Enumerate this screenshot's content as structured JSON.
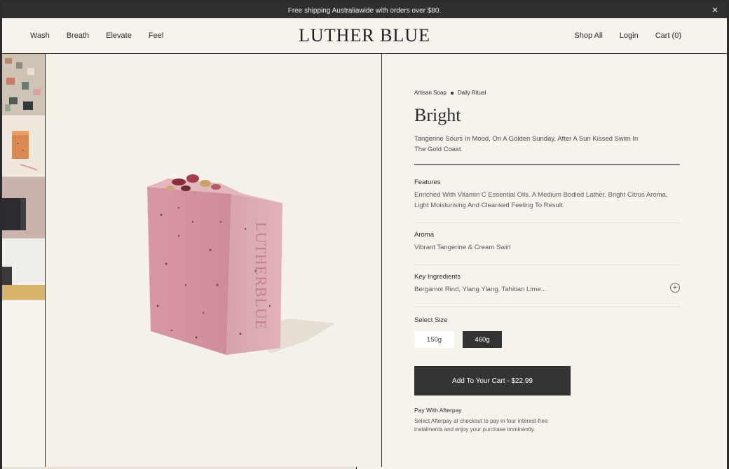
{
  "announcement": {
    "text": "Free shipping Australiawide with orders over $80."
  },
  "brand": {
    "logo": "LUTHER BLUE"
  },
  "nav": {
    "left": [
      "Wash",
      "Breath",
      "Elevate",
      "Feel"
    ],
    "shop_all": "Shop All",
    "login": "Login",
    "cart": "Cart (0)"
  },
  "product": {
    "breadcrumbs": [
      "Artisan Soap",
      "Daily Ritual"
    ],
    "title": "Bright",
    "tagline": "Tangerine Sours In Mood, On A Golden Sunday, After A Sun Kissed Swim In The Gold Coast.",
    "features": {
      "label": "Features",
      "text": "Enriched With Vitamin C Essential Oils. A Medium Bodied Lather. Bright Citrus Aroma, Light Moisturising And Cleansed Feeling To Result."
    },
    "aroma": {
      "label": "Aroma",
      "text": "Vibrant Tangerine & Cream Swirl"
    },
    "ingredients": {
      "label": "Key Ingredients",
      "text": "Bergamot Rind, Ylang Ylang, Tahitian Lime..."
    },
    "size_label": "Select Size",
    "sizes": [
      "150g",
      "460g"
    ],
    "selected_size": "460g",
    "add_to_cart": "Add To Your Cart - $22.99",
    "afterpay": {
      "title": "Pay With Afterpay",
      "text": "Select Afterpay at checkout to pay in four interest-free instalments and enjoy your purchase imminently."
    },
    "soap_imprint": "LUTHERBLUE"
  },
  "colors": {
    "background": "#f6f3ec",
    "dark": "#343434",
    "soap": "#d9a0a8"
  }
}
